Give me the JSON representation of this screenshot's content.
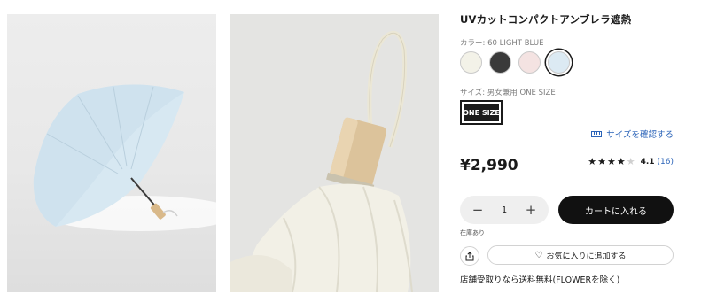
{
  "product": {
    "title": "UVカットコンパクトアンブレラ遮熱",
    "color_label": "カラー: 60 LIGHT BLUE",
    "colors": [
      {
        "name": "off-white",
        "hex": "#f3f2e8"
      },
      {
        "name": "dark-gray",
        "hex": "#3a3a3a"
      },
      {
        "name": "light-pink",
        "hex": "#f4e3e2"
      },
      {
        "name": "light-blue",
        "hex": "#dceaf3",
        "selected": true
      }
    ],
    "size_label": "サイズ: 男女兼用 ONE SIZE",
    "size_option": "ONE SIZE",
    "size_guide_link": "サイズを確認する",
    "price": "¥2,990",
    "rating": {
      "stars": 4,
      "max": 5,
      "value": "4.1",
      "count": "(16)"
    },
    "quantity": "1",
    "quantity_minus": "−",
    "quantity_plus": "+",
    "add_to_cart": "カートに入れる",
    "stock_status": "在庫あり",
    "favorite_button": "お気に入りに追加する",
    "store_pickup_note": "店舗受取りなら送料無料(FLOWERを除く)"
  },
  "icons": {
    "ruler": "ruler-icon",
    "share": "share-icon",
    "heart": "heart-icon",
    "star": "★"
  },
  "accent": {
    "link": "#2a63b8",
    "button": "#111111"
  }
}
